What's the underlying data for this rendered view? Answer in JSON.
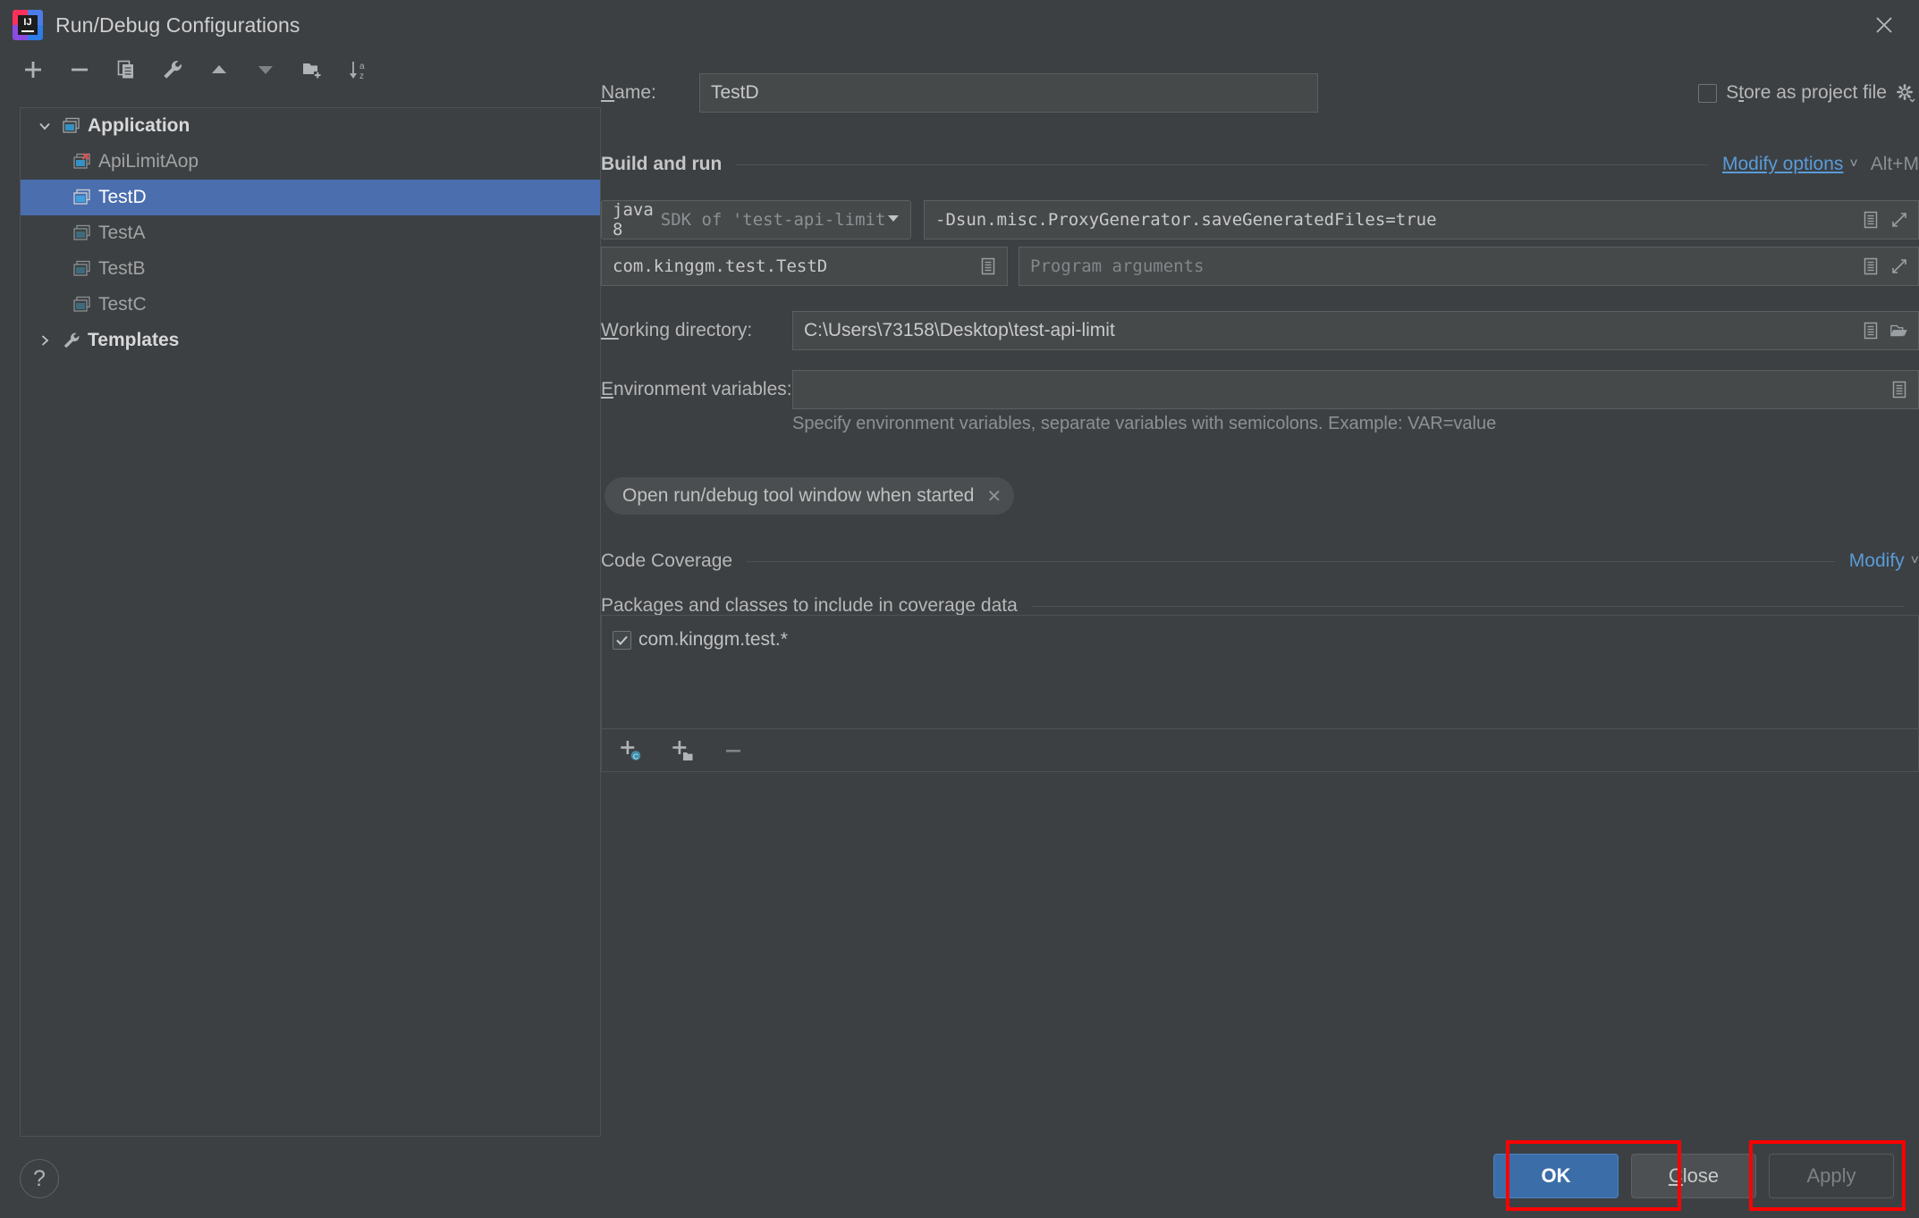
{
  "window": {
    "title": "Run/Debug Configurations",
    "logo_text": "IJ",
    "close_icon": "close-icon"
  },
  "left_toolbar": {
    "items": [
      {
        "name": "add-configuration-button",
        "icon": "plus-icon"
      },
      {
        "name": "remove-configuration-button",
        "icon": "minus-icon"
      },
      {
        "name": "copy-configuration-button",
        "icon": "copy-icon"
      },
      {
        "name": "edit-templates-button",
        "icon": "wrench-icon"
      },
      {
        "name": "move-up-button",
        "icon": "arrow-up-icon"
      },
      {
        "name": "move-down-button",
        "icon": "arrow-down-icon"
      },
      {
        "name": "new-folder-button",
        "icon": "folder-add-icon"
      },
      {
        "name": "sort-configurations-button",
        "icon": "sort-az-icon"
      }
    ]
  },
  "tree": {
    "nodes": [
      {
        "label": "Application",
        "level": 0,
        "expanded": true,
        "icon": "application-icon",
        "selected": false,
        "bold": true
      },
      {
        "label": "ApiLimitAop",
        "level": 1,
        "expanded": null,
        "icon": "application-error-icon",
        "selected": false,
        "bold": false
      },
      {
        "label": "TestD",
        "level": 1,
        "expanded": null,
        "icon": "application-icon",
        "selected": true,
        "bold": false
      },
      {
        "label": "TestA",
        "level": 1,
        "expanded": null,
        "icon": "application-icon",
        "selected": false,
        "bold": false
      },
      {
        "label": "TestB",
        "level": 1,
        "expanded": null,
        "icon": "application-icon",
        "selected": false,
        "bold": false
      },
      {
        "label": "TestC",
        "level": 1,
        "expanded": null,
        "icon": "application-icon",
        "selected": false,
        "bold": false
      },
      {
        "label": "Templates",
        "level": 0,
        "expanded": false,
        "icon": "wrench-icon",
        "selected": false,
        "bold": true
      }
    ]
  },
  "form": {
    "name_label_pre": "N",
    "name_label_post": "ame:",
    "name_value": "TestD",
    "store_as_project_file_label": "Store as project file",
    "store_as_project_file_checked": false,
    "store_gear_icon": "gear-icon",
    "build_and_run_title": "Build and run",
    "modify_options_link": "Modify options",
    "modify_options_shortcut": "Alt+M",
    "sdk_name": "java 8",
    "sdk_sub": "SDK of 'test-api-limit",
    "vm_options_value": "-Dsun.misc.ProxyGenerator.saveGeneratedFiles=true",
    "main_class_value": "com.kinggm.test.TestD",
    "program_arguments_placeholder": "Program arguments",
    "working_directory_label_pre": "W",
    "working_directory_label_post": "orking directory:",
    "working_directory_value": "C:\\Users\\73158\\Desktop\\test-api-limit",
    "env_label_pre": "E",
    "env_label_post": "nvironment variables:",
    "env_value": "",
    "env_hint": "Specify environment variables, separate variables with semicolons. Example: VAR=value",
    "chip_label": "Open run/debug tool window when started",
    "chip_close_icon": "close-icon",
    "expand_icon": "expand-icon",
    "list_icon": "list-icon",
    "browse_icon": "folder-open-icon"
  },
  "coverage": {
    "section_title": "Code Coverage",
    "modify_link": "Modify",
    "list_title": "Packages and classes to include in coverage data",
    "items": [
      {
        "label": "com.kinggm.test.*",
        "checked": true
      }
    ],
    "toolbar": [
      {
        "name": "add-class-button",
        "icon": "add-class-icon"
      },
      {
        "name": "add-package-button",
        "icon": "add-package-icon"
      },
      {
        "name": "remove-pattern-button",
        "icon": "minus-icon"
      }
    ]
  },
  "footer": {
    "help_icon": "question-mark-icon",
    "ok_label": "OK",
    "close_label_pre": "C",
    "close_label_post": "lose",
    "apply_label": "Apply",
    "apply_enabled": false,
    "annotation_color": "#ff0000"
  },
  "colors": {
    "window_bg": "#3c4043",
    "field_bg": "#45494a",
    "selection_blue": "#4b6eaf",
    "link_blue": "#5a9bd8",
    "ok_button": "#3b6ea8",
    "annotation_red": "#ff0000"
  }
}
